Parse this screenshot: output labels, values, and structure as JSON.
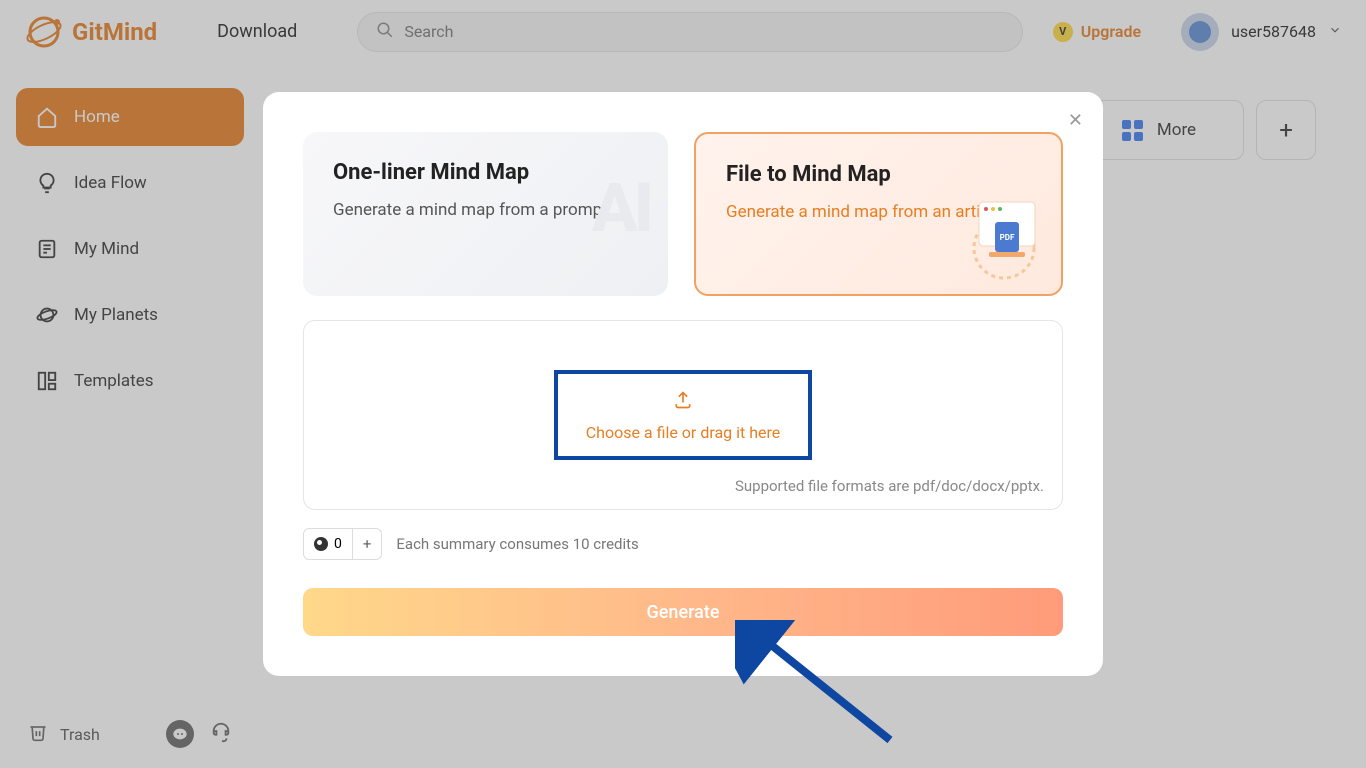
{
  "header": {
    "logo_text": "GitMind",
    "download": "Download",
    "search_placeholder": "Search",
    "upgrade": "Upgrade",
    "upgrade_badge": "V",
    "username": "user587648"
  },
  "sidebar": {
    "items": [
      {
        "label": "Home",
        "icon": "home-icon"
      },
      {
        "label": "Idea Flow",
        "icon": "bulb-icon"
      },
      {
        "label": "My Mind",
        "icon": "doc-icon"
      },
      {
        "label": "My Planets",
        "icon": "planet-icon"
      },
      {
        "label": "Templates",
        "icon": "templates-icon"
      }
    ],
    "trash": "Trash"
  },
  "main": {
    "more": "More"
  },
  "modal": {
    "card_a_title": "One-liner Mind Map",
    "card_a_sub": "Generate a mind map from a prompt",
    "card_a_ghost": "AI",
    "card_b_title": "File to Mind Map",
    "card_b_sub": "Generate a mind map from an article",
    "choose_text": "Choose a file or drag it here",
    "supported": "Supported file formats are pdf/doc/docx/pptx.",
    "credit_count": "0",
    "credit_info": "Each summary consumes 10 credits",
    "generate": "Generate"
  }
}
